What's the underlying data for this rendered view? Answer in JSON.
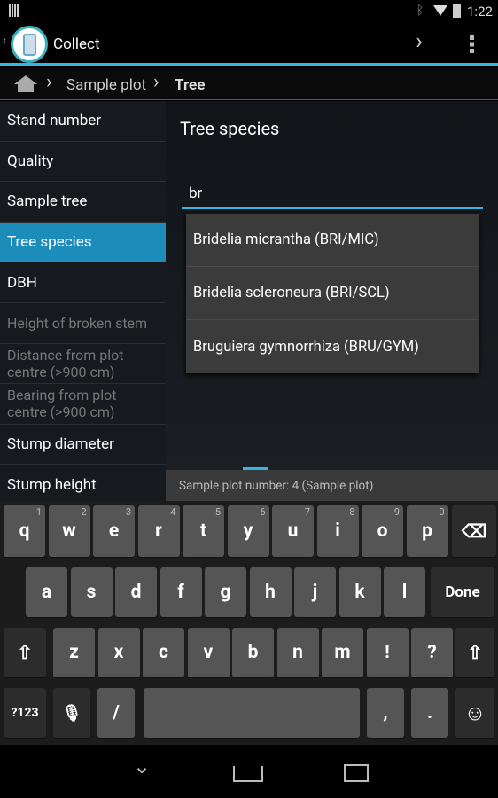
{
  "status": {
    "time": "1:22"
  },
  "actionbar": {
    "title": "Collect"
  },
  "breadcrumb": {
    "items": [
      "Sample plot",
      "Tree"
    ]
  },
  "sidebar": {
    "items": [
      {
        "label": "Stand number",
        "state": "normal"
      },
      {
        "label": "Quality",
        "state": "normal"
      },
      {
        "label": "Sample tree",
        "state": "normal"
      },
      {
        "label": "Tree species",
        "state": "selected"
      },
      {
        "label": "DBH",
        "state": "normal"
      },
      {
        "label": "Height of broken stem",
        "state": "disabled"
      },
      {
        "label": "Distance from plot centre (>900 cm)",
        "state": "disabled"
      },
      {
        "label": "Bearing from plot centre (>900 cm)",
        "state": "disabled"
      },
      {
        "label": "Stump diameter",
        "state": "normal"
      },
      {
        "label": "Stump height",
        "state": "normal"
      }
    ]
  },
  "main": {
    "title": "Tree species",
    "input_value": "br",
    "suggestions": [
      "Bridelia micrantha (BRI/MIC)",
      "Bridelia scleroneura (BRI/SCL)",
      "Bruguiera gymnorrhiza (BRU/GYM)"
    ]
  },
  "footer": {
    "text": "Sample plot number: 4 (Sample plot)"
  },
  "keyboard": {
    "row1": [
      [
        "q",
        "1"
      ],
      [
        "w",
        "2"
      ],
      [
        "e",
        "3"
      ],
      [
        "r",
        "4"
      ],
      [
        "t",
        "5"
      ],
      [
        "y",
        "6"
      ],
      [
        "u",
        "7"
      ],
      [
        "i",
        "8"
      ],
      [
        "o",
        "9"
      ],
      [
        "p",
        "0"
      ]
    ],
    "row2": [
      "a",
      "s",
      "d",
      "f",
      "g",
      "h",
      "j",
      "k",
      "l"
    ],
    "row3": [
      "z",
      "x",
      "c",
      "v",
      "b",
      "n",
      "m",
      "!",
      "?"
    ],
    "done": "Done",
    "symbols": "?123",
    "slash": "/",
    "comma": ",",
    "period": "."
  },
  "colors": {
    "accent": "#33b5e5",
    "selected": "#1c8dba"
  }
}
